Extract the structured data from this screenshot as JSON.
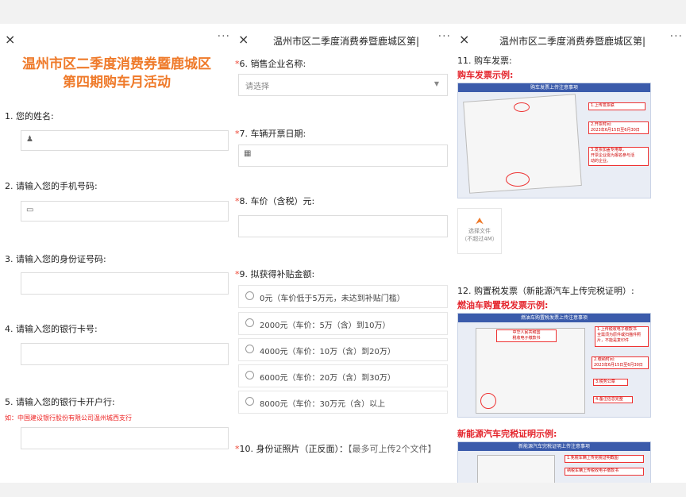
{
  "panel1": {
    "close": "×",
    "more": "···",
    "heading": "温州市区二季度消费券暨鹿城区\n第四期购车月活动",
    "q1": "1. 您的姓名:",
    "q2": "2. 请输入您的手机号码:",
    "q3": "3. 请输入您的身份证号码:",
    "q4": "4. 请输入您的银行卡号:",
    "q5": "5. 请输入您的银行卡开户行:",
    "q5_hint": "如：中国建设银行股份有限公司温州城西支行"
  },
  "panel2": {
    "close": "×",
    "title": "温州市区二季度消费券暨鹿城区第|",
    "more": "···",
    "q6": "6. 销售企业名称:",
    "q6_placeholder": "请选择",
    "q7": "7. 车辆开票日期:",
    "q8": "8. 车价（含税）元:",
    "q9": "9. 拟获得补贴金额:",
    "q9_options": [
      "0元（车价低于5万元，未达到补贴门槛）",
      "2000元（车价：5万（含）到10万）",
      "4000元（车价：10万（含）到20万）",
      "6000元（车价：20万（含）到30万）",
      "8000元（车价：30万元（含）以上"
    ],
    "q10": "10. 身份证照片（正反面）：",
    "q10_note": "【最多可上传2个文件】"
  },
  "panel3": {
    "close": "×",
    "title": "温州市区二季度消费券暨鹿城区第|",
    "more": "···",
    "q11": "11. 购车发票:",
    "q11_example": "购车发票示例:",
    "sample1_band": "购车发票上传注意事项",
    "sample1_notes": [
      "1.上传发票联",
      "2.开票时间:\n2023年6月15日至6月30日",
      "3.发票加盖专用章，\n开票企业需为报名参与活\n动的企业。"
    ],
    "upload_label": "选择文件",
    "upload_limit": "（不超过4M）",
    "q12": "12. 购置税发票（新能源汽车上传完税证明）:",
    "q12_example1": "燃油车购置税发票示例:",
    "sample2_band": "燃油车购置税发票上传注意事项",
    "sample2_notes": [
      "1.上传税收电子缴款书\n全需须为原件或扫描件照\n片，不能是复印件",
      "2.缴纳时间:\n2023年6月15日至6月30日",
      "3.税务公章",
      "4.备注信息完整"
    ],
    "sample2_doc_title": "中华人民共和国\n税收电子缴款书",
    "q12_example2": "新能源汽车完税证明示例:",
    "sample3_band": "新能源汽车完税证明上传注意事项",
    "sample3_notes": [
      "1.免税车辆上传完税证明截图",
      "纳税车辆上传税收电子缴款书"
    ]
  },
  "colors": {
    "accent": "#ef7a2a",
    "required": "#e4232b",
    "band": "#3b5bab"
  }
}
